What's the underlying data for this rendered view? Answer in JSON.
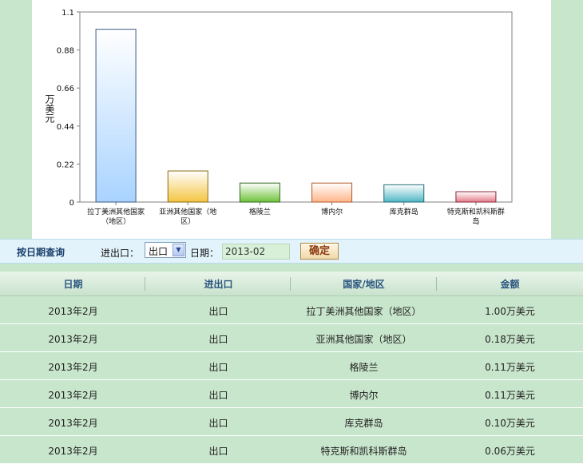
{
  "chart_data": {
    "type": "bar",
    "ylabel": "万美元",
    "ylim": [
      0,
      1.1
    ],
    "yticks": [
      "0",
      "0.22",
      "0.44",
      "0.66",
      "0.88",
      "1.1"
    ],
    "grid": true,
    "categories": [
      [
        "拉丁美洲其他国家",
        "（地区）"
      ],
      [
        "亚洲其他国家（地",
        "区）"
      ],
      [
        "格陵兰"
      ],
      [
        "博内尔"
      ],
      [
        "库克群岛"
      ],
      [
        "特克斯和凯科斯群",
        "岛"
      ]
    ],
    "values": [
      1.0,
      0.18,
      0.11,
      0.11,
      0.1,
      0.06
    ],
    "colors": [
      {
        "top": "#ffffff",
        "bottom": "#a9d3ff",
        "stroke": "#3a5a80"
      },
      {
        "top": "#ffffff",
        "bottom": "#f4c542",
        "stroke": "#8a6a10"
      },
      {
        "top": "#ffffff",
        "bottom": "#6fc23a",
        "stroke": "#2f6a1a"
      },
      {
        "top": "#ffffff",
        "bottom": "#ffb58a",
        "stroke": "#b05a28"
      },
      {
        "top": "#ffffff",
        "bottom": "#4fb6c4",
        "stroke": "#1e6a78"
      },
      {
        "top": "#ffffff",
        "bottom": "#e57b8a",
        "stroke": "#8a2838"
      }
    ]
  },
  "query": {
    "title": "按日期查询",
    "io_label": "进出口：",
    "io_value": "出口",
    "date_label": "日期：",
    "date_value": "2013-02",
    "ok_label": "确定"
  },
  "table": {
    "headers": [
      "日期",
      "进出口",
      "国家/地区",
      "金额"
    ],
    "rows": [
      [
        "2013年2月",
        "出口",
        "拉丁美洲其他国家（地区）",
        "1.00万美元"
      ],
      [
        "2013年2月",
        "出口",
        "亚洲其他国家（地区）",
        "0.18万美元"
      ],
      [
        "2013年2月",
        "出口",
        "格陵兰",
        "0.11万美元"
      ],
      [
        "2013年2月",
        "出口",
        "博内尔",
        "0.11万美元"
      ],
      [
        "2013年2月",
        "出口",
        "库克群岛",
        "0.10万美元"
      ],
      [
        "2013年2月",
        "出口",
        "特克斯和凯科斯群岛",
        "0.06万美元"
      ]
    ]
  },
  "icons": {
    "select_arrow": "chevron-down-icon"
  }
}
